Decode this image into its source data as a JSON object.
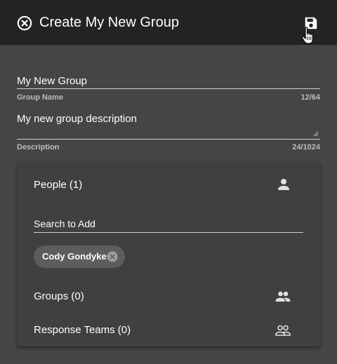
{
  "header": {
    "title": "Create My New Group",
    "close_icon": "close-circle-icon",
    "save_icon": "floppy-disk-icon"
  },
  "form": {
    "group_name": {
      "value": "My New Group",
      "label": "Group Name",
      "counter": "12/64"
    },
    "description": {
      "value": "My new group description",
      "label": "Description",
      "counter": "24/1024"
    }
  },
  "members": {
    "people": {
      "label": "People (1)",
      "icon": "person-icon"
    },
    "search": {
      "placeholder": "Search to Add"
    },
    "chips": [
      {
        "label": "Cody Gondyke",
        "remove_icon": "remove-circle-icon"
      }
    ],
    "groups": {
      "label": "Groups (0)",
      "icon": "people-icon"
    },
    "response_teams": {
      "label": "Response Teams (0)",
      "icon": "people-outline-icon"
    }
  },
  "colors": {
    "header_bg": "#232323",
    "page_bg": "#454545",
    "card_bg": "#404040",
    "chip_bg": "#5d5d5d",
    "text": "#ffffff",
    "helper_text": "#bdbdbd"
  }
}
